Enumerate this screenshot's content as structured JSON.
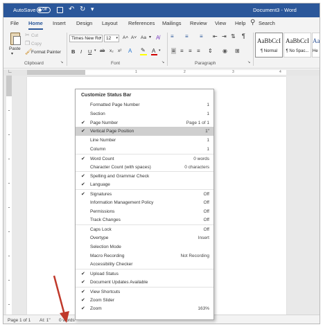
{
  "titlebar": {
    "autosave_label": "AutoSave",
    "autosave_state": "Off",
    "document_title": "Document3 - Word"
  },
  "tabs": [
    "File",
    "Home",
    "Insert",
    "Design",
    "Layout",
    "References",
    "Mailings",
    "Review",
    "View",
    "Help"
  ],
  "active_tab": "Home",
  "search_label": "Search",
  "ribbon": {
    "clipboard": {
      "paste_label": "Paste",
      "cut_label": "Cut",
      "copy_label": "Copy",
      "format_painter_label": "Format Painter",
      "group_label": "Clipboard"
    },
    "font": {
      "font_name": "Times New Ro",
      "font_size": "12",
      "grow_label": "A˄",
      "shrink_label": "A˅",
      "change_case_label": "Aa",
      "clear_label": "A̸",
      "bold": "B",
      "italic": "I",
      "underline": "U",
      "strikethrough": "ab",
      "subscript": "x₂",
      "superscript": "x²",
      "effects": "A",
      "highlight_color": "#ffff00",
      "font_color": "#d00000",
      "font_color_label": "A",
      "group_label": "Font"
    },
    "paragraph": {
      "group_label": "Paragraph"
    },
    "styles": [
      {
        "sample": "AaBbCcI",
        "name": "¶ Normal",
        "selected": true
      },
      {
        "sample": "AaBbCcI",
        "name": "¶ No Spac...",
        "selected": false
      },
      {
        "sample": "AaBb",
        "name": "He",
        "selected": false
      }
    ]
  },
  "ruler": {
    "numbers": [
      "1",
      "2",
      "3",
      "4"
    ]
  },
  "status_bar": {
    "page": "Page 1 of 1",
    "position": "At: 1\"",
    "words": "0 words"
  },
  "menu": {
    "title": "Customize Status Bar",
    "items": [
      {
        "label": "Formatted Page Number",
        "value": "1",
        "checked": false,
        "highlighted": false,
        "separator_before": false
      },
      {
        "label": "Section",
        "value": "1",
        "checked": false,
        "highlighted": false,
        "separator_before": false
      },
      {
        "label": "Page Number",
        "value": "Page 1 of 1",
        "checked": true,
        "highlighted": false,
        "separator_before": false
      },
      {
        "label": "Vertical Page Position",
        "value": "1\"",
        "checked": true,
        "highlighted": true,
        "separator_before": false
      },
      {
        "label": "Line Number",
        "value": "1",
        "checked": false,
        "highlighted": false,
        "separator_before": false
      },
      {
        "label": "Column",
        "value": "1",
        "checked": false,
        "highlighted": false,
        "separator_before": false
      },
      {
        "label": "Word Count",
        "value": "0 words",
        "checked": true,
        "highlighted": false,
        "separator_before": true
      },
      {
        "label": "Character Count (with spaces)",
        "value": "0 characters",
        "checked": false,
        "highlighted": false,
        "separator_before": false
      },
      {
        "label": "Spelling and Grammar Check",
        "value": "",
        "checked": true,
        "highlighted": false,
        "separator_before": true
      },
      {
        "label": "Language",
        "value": "",
        "checked": true,
        "highlighted": false,
        "separator_before": false
      },
      {
        "label": "Signatures",
        "value": "Off",
        "checked": true,
        "highlighted": false,
        "separator_before": true
      },
      {
        "label": "Information Management Policy",
        "value": "Off",
        "checked": false,
        "highlighted": false,
        "separator_before": false
      },
      {
        "label": "Permissions",
        "value": "Off",
        "checked": false,
        "highlighted": false,
        "separator_before": false
      },
      {
        "label": "Track Changes",
        "value": "Off",
        "checked": false,
        "highlighted": false,
        "separator_before": false
      },
      {
        "label": "Caps Lock",
        "value": "Off",
        "checked": false,
        "highlighted": false,
        "separator_before": true
      },
      {
        "label": "Overtype",
        "value": "Insert",
        "checked": false,
        "highlighted": false,
        "separator_before": false
      },
      {
        "label": "Selection Mode",
        "value": "",
        "checked": false,
        "highlighted": false,
        "separator_before": false
      },
      {
        "label": "Macro Recording",
        "value": "Not Recording",
        "checked": false,
        "highlighted": false,
        "separator_before": false
      },
      {
        "label": "Accessibility Checker",
        "value": "",
        "checked": false,
        "highlighted": false,
        "separator_before": false
      },
      {
        "label": "Upload Status",
        "value": "",
        "checked": true,
        "highlighted": false,
        "separator_before": true
      },
      {
        "label": "Document Updates Available",
        "value": "",
        "checked": true,
        "highlighted": false,
        "separator_before": false
      },
      {
        "label": "View Shortcuts",
        "value": "",
        "checked": true,
        "highlighted": false,
        "separator_before": true
      },
      {
        "label": "Zoom Slider",
        "value": "",
        "checked": true,
        "highlighted": false,
        "separator_before": false
      },
      {
        "label": "Zoom",
        "value": "163%",
        "checked": true,
        "highlighted": false,
        "separator_before": false
      }
    ]
  },
  "colors": {
    "titlebar": "#2b579a",
    "annotation_arrow": "#c0392b"
  }
}
